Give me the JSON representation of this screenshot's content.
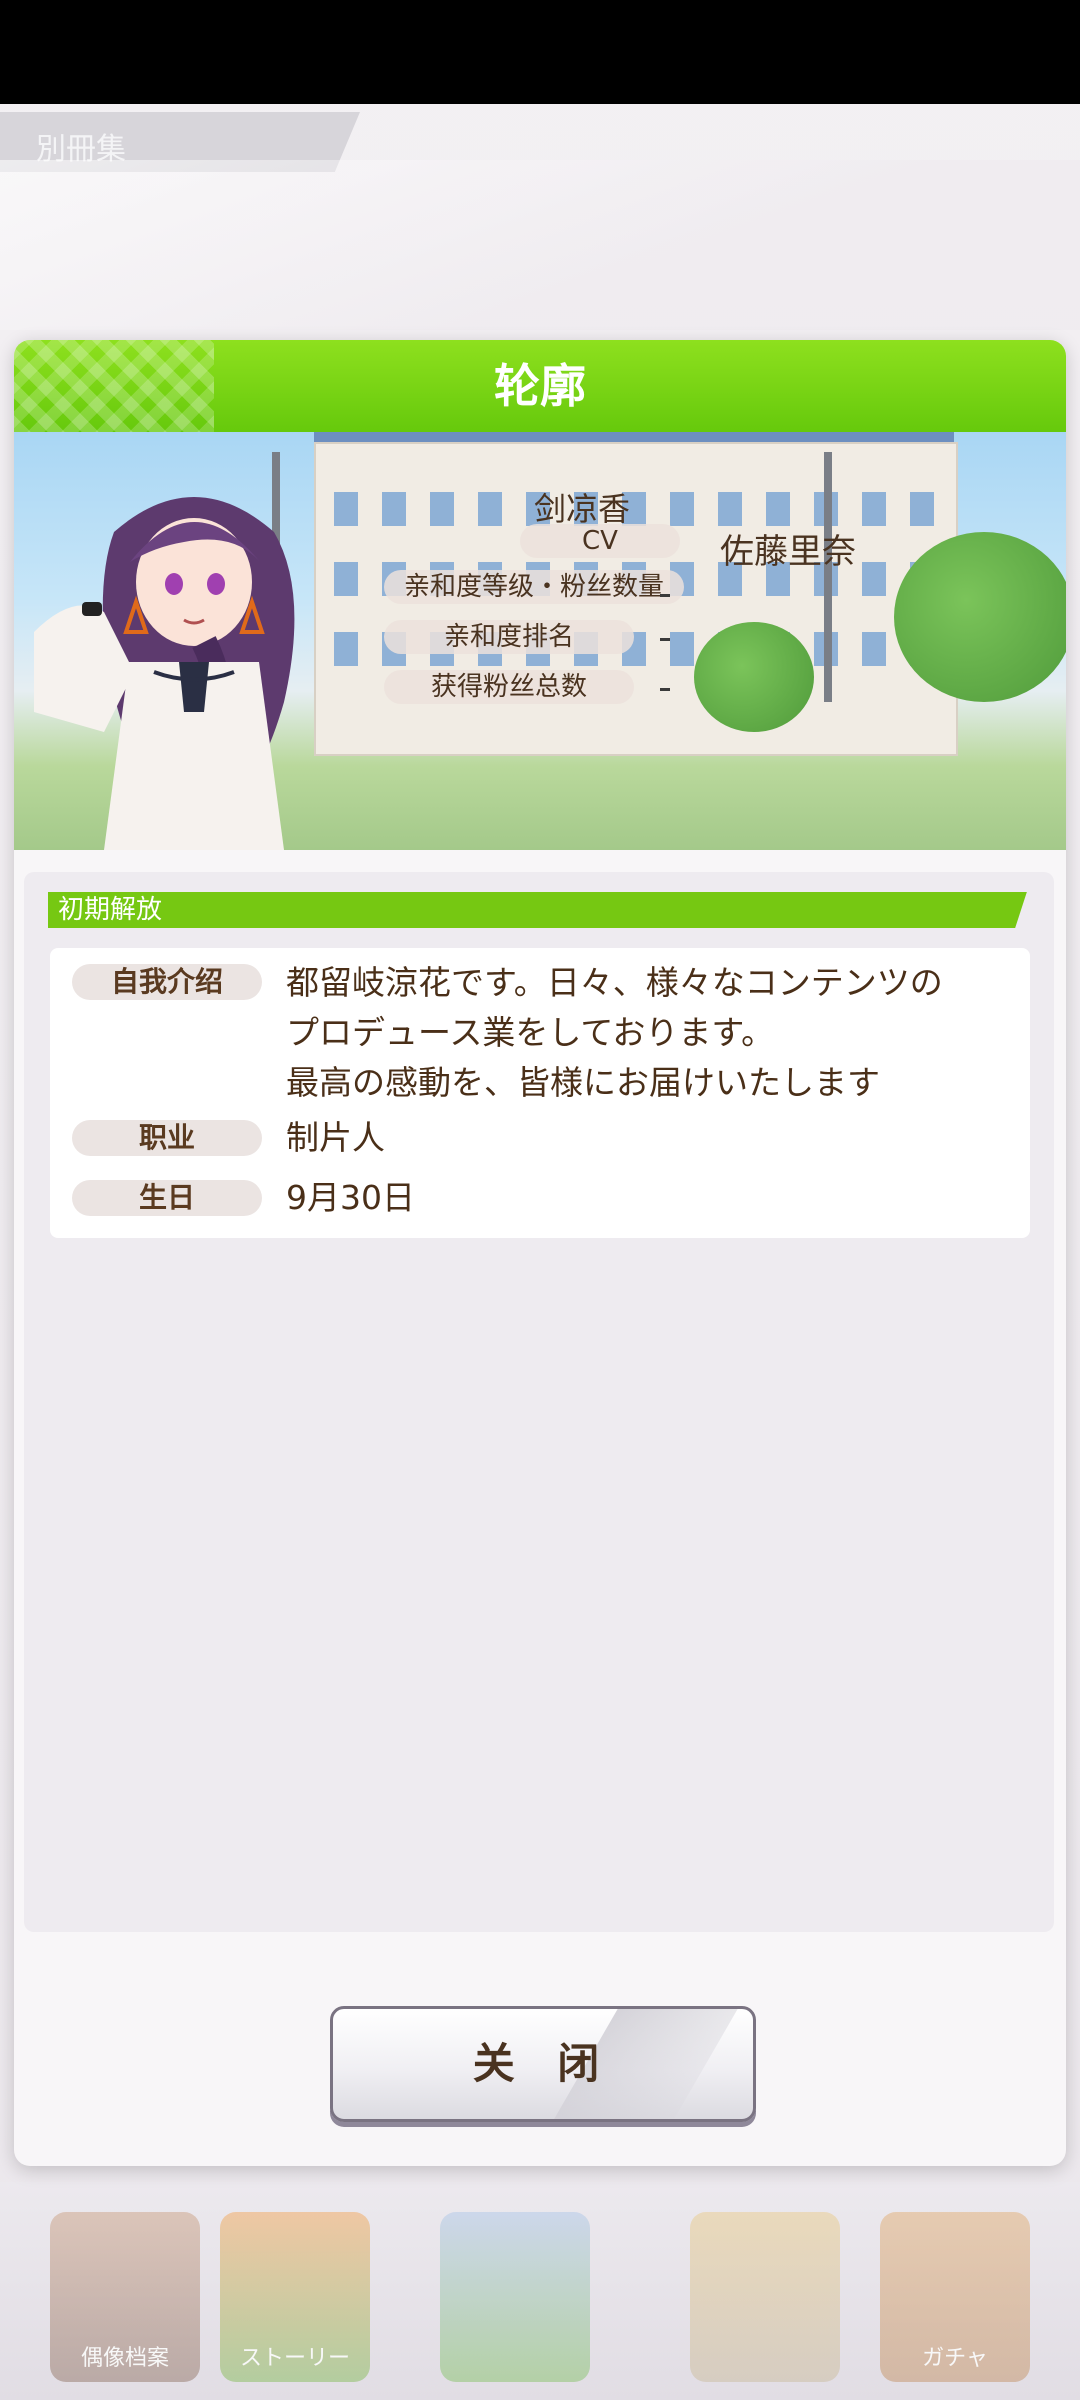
{
  "background": {
    "tab_label": "別冊集",
    "nav_labels": [
      "偶像档案",
      "ストーリー",
      "",
      "",
      "ガチャ"
    ]
  },
  "dialog": {
    "title": "轮廓",
    "profile": {
      "name": "剑凉香",
      "cv_label": "CV",
      "cv_value": "佐藤里奈",
      "affinity_level_label": "亲和度等级・粉丝数量",
      "affinity_rank_label": "亲和度排名",
      "total_fans_label": "获得粉丝总数"
    },
    "section_label": "初期解放",
    "details": {
      "intro_label": "自我介绍",
      "intro_lines": [
        "都留岐涼花です。日々、様々なコンテンツの",
        "プロデュース業をしております。",
        "最高の感動を、皆様にお届けいたします"
      ],
      "job_label": "职业",
      "job_value": "制片人",
      "birthday_label": "生日",
      "birthday_value": "9月30日"
    },
    "close_label": "关 闭"
  },
  "colors": {
    "header_green": "#6acb0e",
    "text_brown": "#4a3320",
    "label_bg": "#ebe4e2"
  }
}
